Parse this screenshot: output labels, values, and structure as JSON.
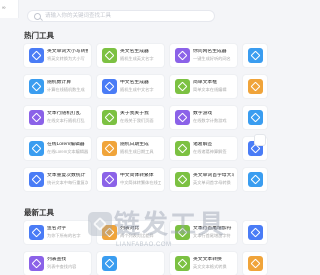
{
  "sidebar": {
    "icon_glyph": "∞"
  },
  "search": {
    "placeholder": "请输入你的关键词查找工具"
  },
  "sections": {
    "hot_title": "热门工具",
    "recent_title": "最新工具"
  },
  "hot_tools": [
    {
      "title": "英文单词大小写转换",
      "desc": "将英文转换为大小写",
      "color": "#4a7cf6"
    },
    {
      "title": "英文名生成器",
      "desc": "随机生成英文名字",
      "color": "#7cc142"
    },
    {
      "title": "你问网名生成器",
      "desc": "一键生成好听的网名",
      "color": "#8b62e8"
    },
    {
      "title": "",
      "desc": "",
      "color": "#3a9df0"
    },
    {
      "title": "随机数计算",
      "desc": "计算在线随机数生成",
      "color": "#3a9df0"
    },
    {
      "title": "中文名生成器",
      "desc": "随机生成中文名字",
      "color": "#4a7cf6"
    },
    {
      "title": "简单文本框",
      "desc": "简单文本在线编辑",
      "color": "#7cc142"
    },
    {
      "title": "",
      "desc": "",
      "color": "#f0a43a"
    },
    {
      "title": "文本行随机打乱",
      "desc": "在线文本行随机打乱",
      "color": "#8b62e8"
    },
    {
      "title": "关于我关于我",
      "desc": "在线关于我们页面",
      "color": "#7cc142"
    },
    {
      "title": "数字游戏",
      "desc": "在线数字计数游戏",
      "color": "#8b62e8"
    },
    {
      "title": "",
      "desc": "",
      "color": "#3a9df0"
    },
    {
      "title": "在线Lorem编辑器",
      "desc": "在线Lorem文本编辑器",
      "color": "#3a9df0"
    },
    {
      "title": "随机日期生成",
      "desc": "随机生成日期工具",
      "color": "#f0a43a"
    },
    {
      "title": "诸葛解签",
      "desc": "在线诸葛神算解签",
      "color": "#7cc142"
    },
    {
      "title": "",
      "desc": "",
      "color": "#4a7cf6"
    },
    {
      "title": "文本重复次数统计",
      "desc": "统计文本中每行重复次数",
      "color": "#4a7cf6"
    },
    {
      "title": "中文简体转繁体",
      "desc": "中文简体转繁体在线工具",
      "color": "#8b62e8"
    },
    {
      "title": "英文单词首字母大写",
      "desc": "英文单词首字母转换",
      "color": "#7cc142"
    },
    {
      "title": "",
      "desc": "",
      "color": "#3a9df0"
    }
  ],
  "recent_tools": [
    {
      "title": "鱼名对字",
      "desc": "为你下所有的名字",
      "color": "#4a7cf6"
    },
    {
      "title": "列表对比",
      "desc": "两个列表对比差异",
      "color": "#f0a43a"
    },
    {
      "title": "文本行首尾增加符",
      "desc": "文本行首尾增加字符",
      "color": "#7cc142"
    },
    {
      "title": "",
      "desc": "",
      "color": "#4a7cf6"
    },
    {
      "title": "列表查找",
      "desc": "列表中查找内容",
      "color": "#8b62e8"
    },
    {
      "title": "",
      "desc": "",
      "color": "#3a9df0"
    },
    {
      "title": "英文文本转换",
      "desc": "英文文本格式转换",
      "color": "#7cc142"
    },
    {
      "title": "",
      "desc": "",
      "color": "#f0a43a"
    }
  ],
  "watermark": {
    "text": "链发工具",
    "sub": "LIANFABAO.COM"
  }
}
